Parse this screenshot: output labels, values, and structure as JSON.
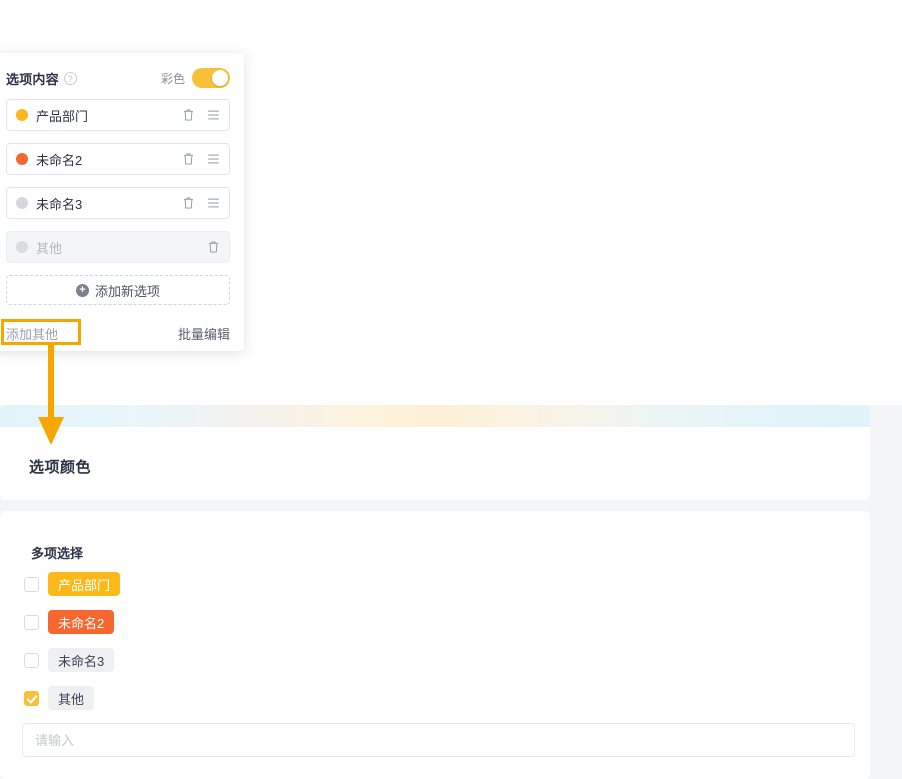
{
  "editor_panel": {
    "title": "选项内容",
    "help_icon": "question-circle-icon",
    "color_toggle": {
      "label": "彩色",
      "state": "on",
      "accent": "#f8c038"
    },
    "options": [
      {
        "label": "产品部门",
        "color": "#fcb818",
        "disabled": false,
        "delete_icon": "trash-icon",
        "drag_icon": "drag-handle-icon"
      },
      {
        "label": "未命名2",
        "color": "#f5672e",
        "disabled": false,
        "delete_icon": "trash-icon",
        "drag_icon": "drag-handle-icon"
      },
      {
        "label": "未命名3",
        "color": "#d5d8dd",
        "disabled": false,
        "delete_icon": "trash-icon",
        "drag_icon": "drag-handle-icon"
      },
      {
        "label": "其他",
        "color": "#d9dce1",
        "disabled": true,
        "delete_icon": "trash-icon",
        "drag_icon": ""
      }
    ],
    "add_option_label": "添加新选项",
    "add_option_icon": "plus-circle-icon",
    "footer": {
      "add_other_label": "添加其他",
      "batch_edit_label": "批量编辑"
    }
  },
  "annotation": {
    "highlight_color": "#f5a700",
    "arrow_color": "#f5a700",
    "target": "添加其他"
  },
  "preview": {
    "card_title": "选项颜色",
    "field_label": "多项选择",
    "checkboxes": [
      {
        "label": "产品部门",
        "checked": false,
        "bg": "#fcb818",
        "fg": "#ffffff"
      },
      {
        "label": "未命名2",
        "checked": false,
        "bg": "#f5672e",
        "fg": "#ffffff"
      },
      {
        "label": "未命名3",
        "checked": false,
        "bg": "#eff0f2",
        "fg": "#3b4252"
      },
      {
        "label": "其他",
        "checked": true,
        "bg": "#eff0f2",
        "fg": "#3b4252"
      }
    ],
    "other_input": {
      "value": "",
      "placeholder": "请输入"
    }
  }
}
